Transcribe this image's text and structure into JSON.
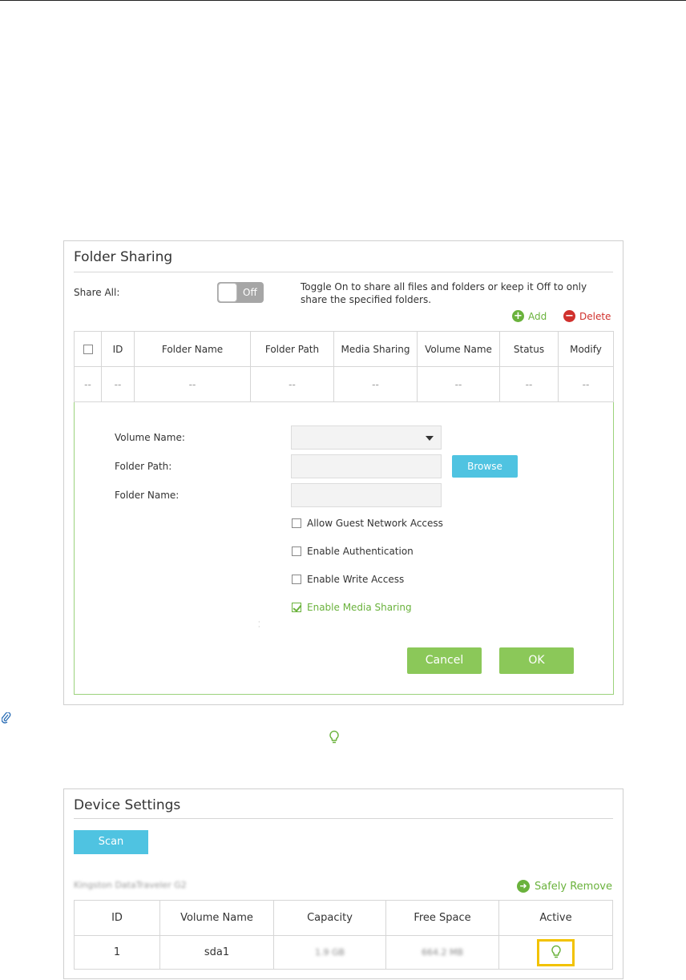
{
  "folder_sharing": {
    "title": "Folder Sharing",
    "share_all_label": "Share All:",
    "toggle_state": "Off",
    "hint": "Toggle On to share all files and folders or keep it Off to only share the specified folders.",
    "add_label": "Add",
    "delete_label": "Delete",
    "columns": [
      "ID",
      "Folder Name",
      "Folder Path",
      "Media Sharing",
      "Volume Name",
      "Status",
      "Modify"
    ],
    "empty_row": [
      "--",
      "--",
      "--",
      "--",
      "--",
      "--",
      "--",
      "--"
    ],
    "form": {
      "volume_name_label": "Volume Name:",
      "folder_path_label": "Folder Path:",
      "folder_name_label": "Folder Name:",
      "browse_label": "Browse",
      "allow_guest_label": "Allow Guest Network Access",
      "enable_auth_label": "Enable Authentication",
      "enable_write_label": "Enable Write Access",
      "enable_media_label": "Enable Media Sharing",
      "cancel_label": "Cancel",
      "ok_label": "OK"
    }
  },
  "device_settings": {
    "title": "Device Settings",
    "scan_label": "Scan",
    "device_name": "Kingston DataTraveler G2",
    "safely_remove_label": "Safely Remove",
    "columns": [
      "ID",
      "Volume Name",
      "Capacity",
      "Free Space",
      "Active"
    ],
    "rows": [
      {
        "id": "1",
        "volume": "sda1",
        "capacity": "1.9 GB",
        "free": "664.2 MB"
      }
    ]
  },
  "colors": {
    "accent_green": "#6ab23c",
    "button_green": "#8bc859",
    "button_blue": "#4fc3e1",
    "delete_red": "#d0312d",
    "highlight_yellow": "#f2c200"
  }
}
